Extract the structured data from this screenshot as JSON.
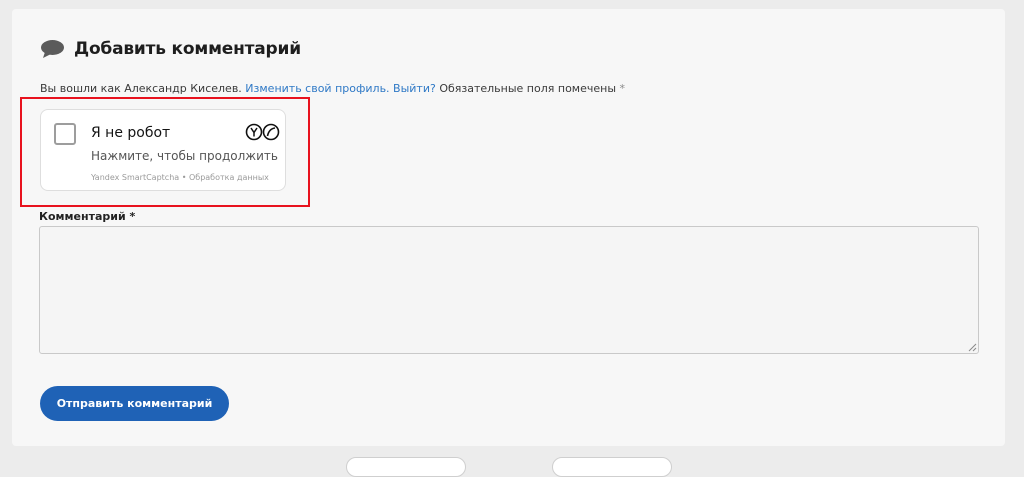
{
  "comment_form": {
    "title": "Добавить комментарий",
    "title_icon": "speech-bubble-icon",
    "logged_in_text": "Вы вошли как Александр Киселев.",
    "edit_profile_link": "Изменить свой профиль.",
    "logout_link": "Выйти?",
    "required_note": "Обязательные поля помечены",
    "required_marker": "*",
    "comment_label": "Комментарий *",
    "comment_value": "",
    "submit_label": "Отправить комментарий"
  },
  "captcha": {
    "title": "Я не робот",
    "subtitle": "Нажмите, чтобы продолжить",
    "footer": "Yandex SmartCaptcha • Обработка данных",
    "checked": false,
    "logo_icon": "yandex-smartcaptcha-logo-icon"
  },
  "colors": {
    "accent": "#1f62b6",
    "link": "#2f79c6",
    "highlight": "#e8121e"
  }
}
